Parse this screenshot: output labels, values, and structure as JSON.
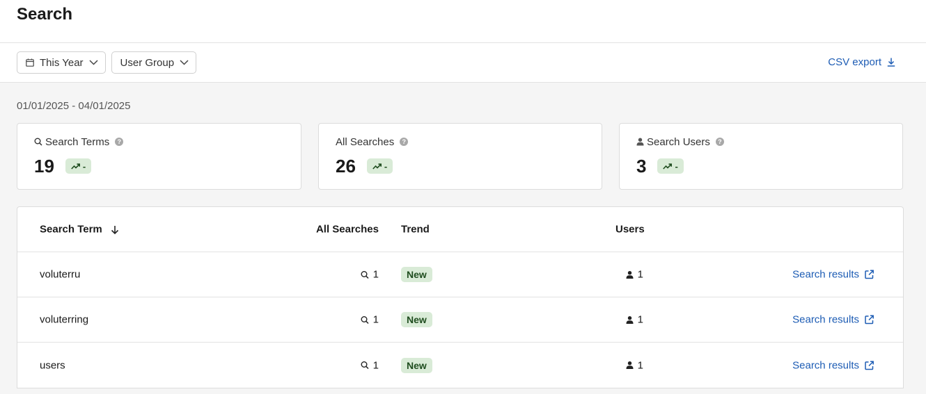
{
  "page": {
    "title": "Search"
  },
  "toolbar": {
    "period_label": "This Year",
    "group_label": "User Group",
    "csv_label": "CSV export"
  },
  "date_range": "01/01/2025 - 04/01/2025",
  "cards": [
    {
      "title": "Search Terms",
      "icon": "search-icon",
      "value": "19",
      "trend": "-"
    },
    {
      "title": "All Searches",
      "icon": "",
      "value": "26",
      "trend": "-"
    },
    {
      "title": "Search Users",
      "icon": "user-icon",
      "value": "3",
      "trend": "-"
    }
  ],
  "table": {
    "headers": {
      "term": "Search Term",
      "all": "All Searches",
      "trend": "Trend",
      "users": "Users"
    },
    "rows": [
      {
        "term": "voluterru",
        "searches": "1",
        "trend": "New",
        "users": "1",
        "link": "Search results"
      },
      {
        "term": "voluterring",
        "searches": "1",
        "trend": "New",
        "users": "1",
        "link": "Search results"
      },
      {
        "term": "users",
        "searches": "1",
        "trend": "New",
        "users": "1",
        "link": "Search results"
      }
    ]
  },
  "colors": {
    "accent": "#1d5cb4",
    "badge_bg": "#d9ebd7",
    "badge_fg": "#1f4d1f"
  }
}
